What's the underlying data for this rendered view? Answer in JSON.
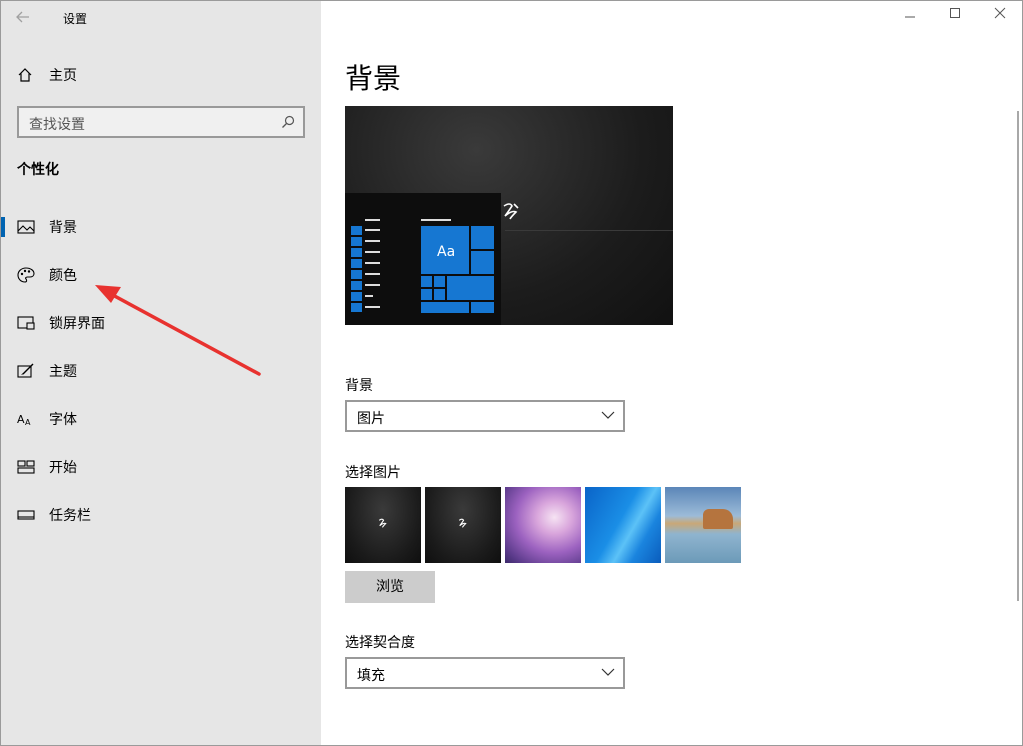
{
  "window": {
    "title": "设置"
  },
  "sidebar": {
    "home_label": "主页",
    "search_placeholder": "查找设置",
    "section_title": "个性化",
    "items": [
      {
        "label": "背景",
        "icon": "image-icon",
        "active": true
      },
      {
        "label": "颜色",
        "icon": "palette-icon",
        "active": false
      },
      {
        "label": "锁屏界面",
        "icon": "lock-screen-icon",
        "active": false
      },
      {
        "label": "主题",
        "icon": "theme-icon",
        "active": false
      },
      {
        "label": "字体",
        "icon": "font-icon",
        "active": false
      },
      {
        "label": "开始",
        "icon": "start-icon",
        "active": false
      },
      {
        "label": "任务栏",
        "icon": "taskbar-icon",
        "active": false
      }
    ]
  },
  "main": {
    "title": "背景",
    "preview": {
      "tile_label": "Aa"
    },
    "background_label": "背景",
    "background_value": "图片",
    "choose_picture_label": "选择图片",
    "browse_label": "浏览",
    "fit_label": "选择契合度",
    "fit_value": "填充"
  },
  "colors": {
    "accent": "#0063b1",
    "tile_blue": "#1677d2",
    "annotation": "#e8322f"
  }
}
